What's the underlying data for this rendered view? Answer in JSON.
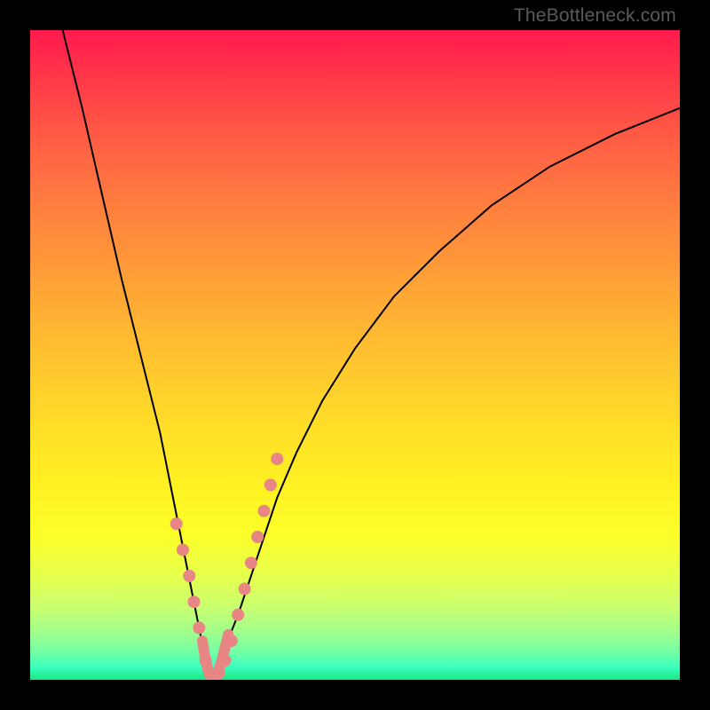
{
  "watermark": "TheBottleneck.com",
  "chart_data": {
    "type": "line",
    "title": "",
    "xlabel": "",
    "ylabel": "",
    "xlim": [
      0,
      100
    ],
    "ylim": [
      0,
      100
    ],
    "notch_x": 28,
    "series": [
      {
        "name": "bottleneck-curve",
        "x": [
          5,
          8,
          11,
          14,
          17,
          20,
          22,
          24,
          26,
          27,
          28,
          29,
          30,
          32,
          34,
          36,
          38,
          41,
          45,
          50,
          56,
          63,
          71,
          80,
          90,
          100
        ],
        "y": [
          100,
          88,
          75,
          62,
          50,
          38,
          28,
          18,
          8,
          3,
          0,
          2,
          5,
          10,
          16,
          22,
          28,
          35,
          43,
          51,
          59,
          66,
          73,
          79,
          84,
          88
        ]
      }
    ],
    "markers": {
      "name": "highlight-dots",
      "x": [
        22.5,
        23.5,
        24.5,
        25.2,
        26.0,
        27.0,
        28.0,
        29.0,
        30.0,
        31.0,
        32.0,
        33.0,
        34.0,
        35.0,
        36.0,
        37.0,
        38.0
      ],
      "y": [
        24,
        20,
        16,
        12,
        8,
        3,
        0,
        1,
        3,
        6,
        10,
        14,
        18,
        22,
        26,
        30,
        34
      ]
    }
  }
}
